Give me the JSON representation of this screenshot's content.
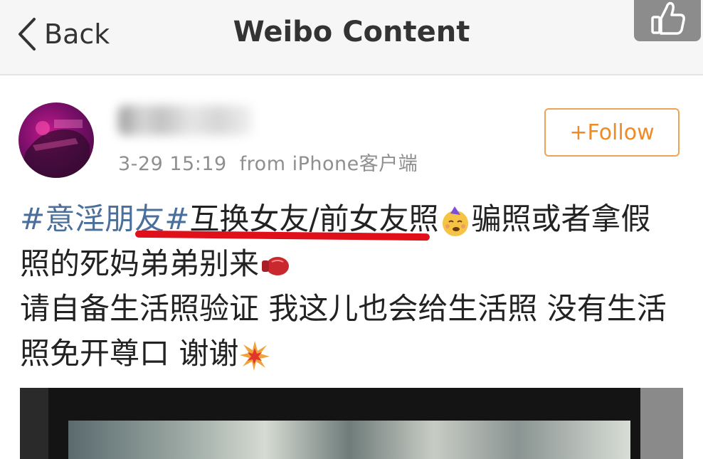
{
  "nav": {
    "back_label": "Back",
    "title": "Weibo Content"
  },
  "post": {
    "timestamp": "3-29 15:19",
    "source": "from iPhone客户端",
    "follow_label": "+Follow",
    "text": {
      "topic": "#意淫朋友#",
      "line1_rest": "互换女友/前女友照",
      "line1_tail": "骗照或者拿假",
      "line2": "照的死妈弟弟别来",
      "line3": "请自备生活照验证 我这儿也会给生活照 没有生活",
      "line4": "照免开尊口 谢谢"
    }
  },
  "icons": {
    "back": "chevron-left-icon",
    "like": "thumbs-up-icon",
    "emoji1": "party-face-emoji",
    "emoji2": "boxing-glove-emoji",
    "emoji3": "collision-emoji"
  },
  "colors": {
    "topic": "#4b6f9b",
    "follow": "#ef8a24",
    "underline": "#e0101a"
  }
}
